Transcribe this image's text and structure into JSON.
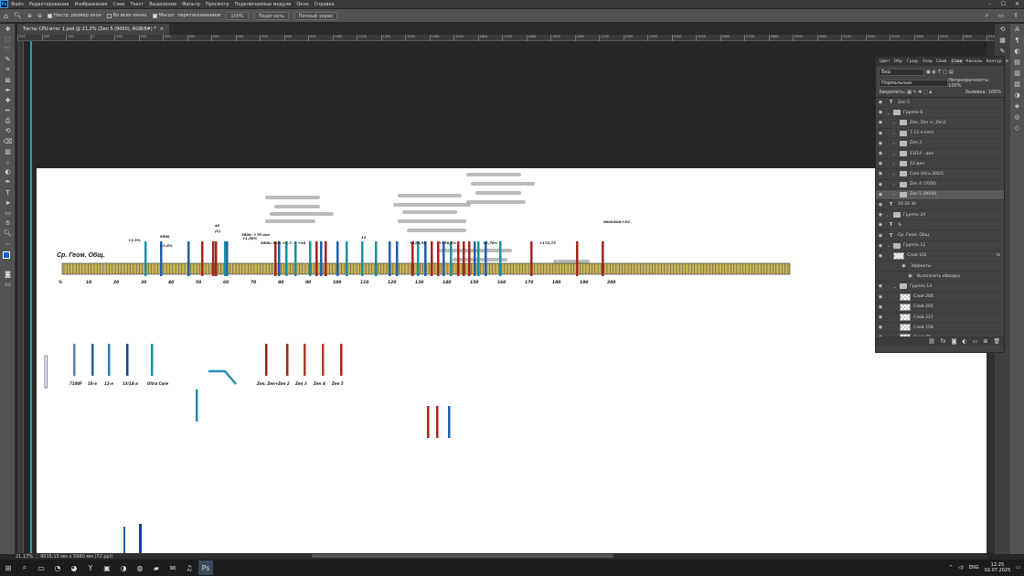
{
  "menu": [
    "Файл",
    "Редактирование",
    "Изображение",
    "Слои",
    "Текст",
    "Выделение",
    "Фильтр",
    "Просмотр",
    "Подключаемые модули",
    "Окно",
    "Справка"
  ],
  "options": {
    "resize": "Настр. размер окон",
    "all_windows": "Во всех окнах",
    "scrubby": "Масшт. перетаскиванием",
    "zoom": "100%",
    "fit": "Подогнать",
    "fill": "Полный экран"
  },
  "tab": {
    "title": "Тесты CPU-итог 1.psd @ 21,2% (Zen 5 (9000), RGB/8#) *",
    "close": "×"
  },
  "ruler_ticks": [
    "300",
    "200",
    "100",
    "0",
    "100",
    "200",
    "300",
    "400",
    "500",
    "600",
    "700",
    "800",
    "900",
    "1000",
    "1100",
    "1200",
    "1300",
    "1400",
    "1500",
    "1600",
    "1700",
    "1800",
    "1900",
    "2000",
    "2100",
    "2200",
    "2300",
    "2400",
    "2500",
    "2600",
    "2700",
    "2800",
    "2900",
    "3000",
    "3100",
    "3200",
    "3300",
    "3400",
    "3500",
    "3600",
    "3700"
  ],
  "status": {
    "zoom": "21,17%",
    "size": "9015,15 мм x 5980 мм (72 ppi)"
  },
  "chart": {
    "title": "Ср. Геом. Общ.",
    "axis": [
      "%",
      "10",
      "20",
      "30",
      "40",
      "50",
      "60",
      "70",
      "80",
      "90",
      "100",
      "110",
      "120",
      "130",
      "140",
      "150",
      "160",
      "170",
      "180",
      "190",
      "200"
    ],
    "labels_top": [
      "+1,3%",
      "9500",
      "+1,6%",
      "45",
      "(C)",
      "+1,56%",
      "3600: +76 пун",
      "5600; Ur2; +7,7 ... +49",
      "13",
      "+128,56",
      "+178,5%",
      "+1,78%",
      "+172,75",
      "9000ЗU8/+52"
    ],
    "legend_intel": [
      "7100F",
      "10-я",
      "12-я",
      "13/14-я",
      "Ultra Core"
    ],
    "legend_amd": [
      "Zen, Zen+",
      "Zen 2",
      "Zen 3",
      "Zen 4",
      "Zen 5"
    ]
  },
  "layers": {
    "tabs": [
      "Цвет",
      "Обр.",
      "Град.",
      "Узор",
      "Свой.",
      "Слои",
      "Каналы",
      "Контур"
    ],
    "active_tab": "Слои",
    "search": "Вид",
    "blend": "Нормальные",
    "opacity_label": "Непрозрачность:",
    "opacity": "100%",
    "lock_label": "Закрепить:",
    "fill_label": "Заливка:",
    "fill": "100%",
    "rows": [
      {
        "name": "Zen 5",
        "type": "text",
        "ind": 0
      },
      {
        "name": "Группа 6",
        "type": "folder",
        "ind": 0,
        "open": true
      },
      {
        "name": "Zen, Zen +, Zen2",
        "type": "folder",
        "ind": 1
      },
      {
        "name": "7-11-я Intel",
        "type": "folder",
        "ind": 1
      },
      {
        "name": "Zen 3",
        "type": "folder",
        "ind": 1
      },
      {
        "name": "13/14 - ден",
        "type": "folder",
        "ind": 1
      },
      {
        "name": "12-ден",
        "type": "folder",
        "ind": 1
      },
      {
        "name": "Core Ultra 200/5",
        "type": "folder",
        "ind": 1
      },
      {
        "name": "Zen 4 (7000)",
        "type": "folder",
        "ind": 1
      },
      {
        "name": "Zen 5 (9000)",
        "type": "folder",
        "ind": 1,
        "sel": true
      },
      {
        "name": "10            20            30",
        "type": "text",
        "ind": 0
      },
      {
        "name": "Группа 24",
        "type": "folder",
        "ind": 0
      },
      {
        "name": "%",
        "type": "text",
        "ind": 0
      },
      {
        "name": "Ср. Геом. Общ.",
        "type": "text",
        "ind": 0
      },
      {
        "name": "Группа 12",
        "type": "folder",
        "ind": 0,
        "open": true
      },
      {
        "name": "Слой 102",
        "type": "layer",
        "ind": 1,
        "fx": "fx"
      },
      {
        "name": "Эффекты",
        "type": "effect",
        "ind": 2
      },
      {
        "name": "Выполнить обводку",
        "type": "effect",
        "ind": 3
      },
      {
        "name": "Группа 13",
        "type": "folder",
        "ind": 1,
        "open": true
      },
      {
        "name": "Слой 206",
        "type": "layer",
        "ind": 2
      },
      {
        "name": "Слой 205",
        "type": "layer",
        "ind": 2
      },
      {
        "name": "Слой 227",
        "type": "layer",
        "ind": 2
      },
      {
        "name": "Слой 158",
        "type": "layer",
        "ind": 2
      },
      {
        "name": "Слой 78",
        "type": "layer",
        "ind": 2
      }
    ]
  },
  "tray": {
    "lang": "ENG",
    "time": "12:25",
    "date": "02.07.2025"
  },
  "colors": {
    "intel_blue": "#1f5fa8",
    "amd_red": "#a3261d",
    "teal": "#1b8ea0",
    "bar_gold": "#c9b45a"
  }
}
